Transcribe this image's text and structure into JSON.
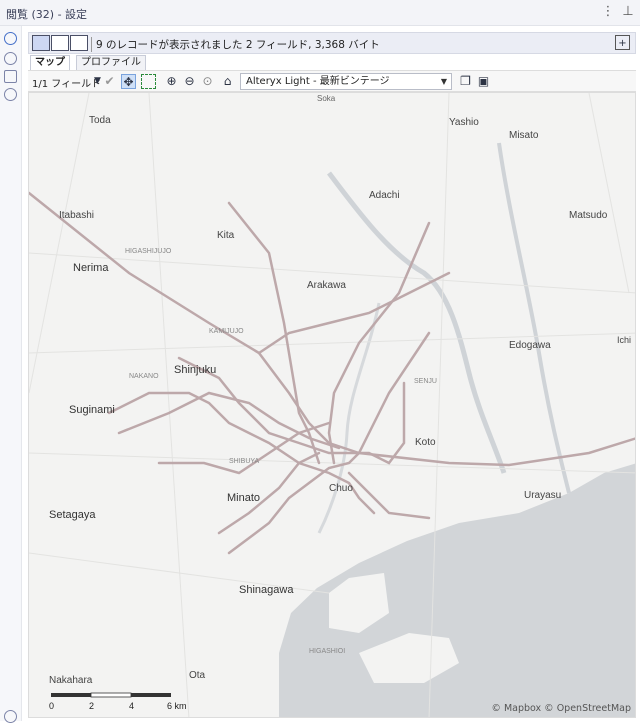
{
  "window": {
    "title": "閲覧 (32) - 設定"
  },
  "toolbar": {
    "record_info": "9 のレコードが表示されました 2 フィールド, 3,368 バイト"
  },
  "tabs": [
    {
      "label": "マップ"
    },
    {
      "label": "プロファイル"
    }
  ],
  "map_toolbar": {
    "field_selector": "1/1 フィールド",
    "basemap_style": "Alteryx Light - 最新ビンテージ"
  },
  "map": {
    "labels": [
      {
        "text": "Soka"
      },
      {
        "text": "Toda"
      },
      {
        "text": "Yashio"
      },
      {
        "text": "Misato"
      },
      {
        "text": "Adachi"
      },
      {
        "text": "Itabashi"
      },
      {
        "text": "Kita"
      },
      {
        "text": "Matsudo"
      },
      {
        "text": "Nerima"
      },
      {
        "text": "Arakawa"
      },
      {
        "text": "Edogawa"
      },
      {
        "text": "Shinjuku"
      },
      {
        "text": "Suginami"
      },
      {
        "text": "Koto"
      },
      {
        "text": "Chuo"
      },
      {
        "text": "Minato"
      },
      {
        "text": "Urayasu"
      },
      {
        "text": "Setagaya"
      },
      {
        "text": "Shinagawa"
      },
      {
        "text": "Ota"
      },
      {
        "text": "Nakahara"
      },
      {
        "text": "Ichi"
      },
      {
        "text": "KAMIJUJO"
      },
      {
        "text": "HIGASHIJUJO"
      },
      {
        "text": "SENJU"
      },
      {
        "text": "NAKANO"
      },
      {
        "text": "SHIBUYA"
      },
      {
        "text": "HIGASHIOI"
      }
    ],
    "scale_labels": [
      "0",
      "2",
      "4",
      "6 km"
    ],
    "attribution": "© Mapbox © OpenStreetMap"
  },
  "colors": {
    "route": "#bda8aa",
    "water": "#d0d3d6",
    "land": "#f3f3f2"
  }
}
